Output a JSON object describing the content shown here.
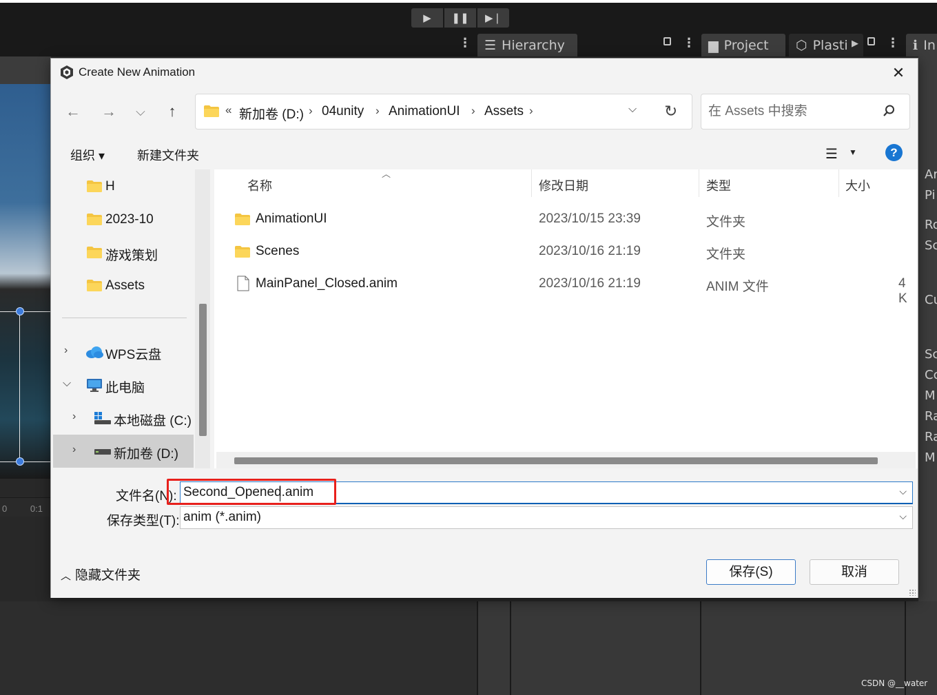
{
  "unity": {
    "tabs": {
      "hierarchy": "Hierarchy",
      "project": "Project",
      "plastic": "Plasti",
      "inspector": "In"
    },
    "right_strip_labels": [
      "Ar",
      "Pi",
      "Ro",
      "Sc",
      "Cu",
      "Sc",
      "Cc",
      "M",
      "Ra",
      "Ra",
      "M"
    ],
    "timeline_ticks": [
      "0",
      "0:1"
    ],
    "watermark": "CSDN @__water"
  },
  "dialog": {
    "title": "Create New Animation",
    "close_glyph": "✕",
    "nav": {
      "back_glyph": "←",
      "forward_glyph": "→",
      "recent_glyph": "⌵",
      "up_glyph": "↑",
      "breadcrumb_prefix": "«",
      "breadcrumbs": [
        "新加卷 (D:)",
        "04unity",
        "AnimationUI",
        "Assets"
      ],
      "search_placeholder": "在 Assets 中搜索"
    },
    "toolbar": {
      "organize": "组织 ▾",
      "new_folder": "新建文件夹",
      "help": "?"
    },
    "sidebar": {
      "quick_items": [
        "H",
        "2023-10",
        "游戏策划",
        "Assets"
      ],
      "wps": "WPS云盘",
      "this_pc": "此电脑",
      "drive_c": "本地磁盘 (C:)",
      "drive_d": "新加卷 (D:)"
    },
    "columns": {
      "name": "名称",
      "date": "修改日期",
      "type": "类型",
      "size": "大小"
    },
    "files": [
      {
        "name": "AnimationUI",
        "date": "2023/10/15 23:39",
        "type": "文件夹",
        "size": "",
        "kind": "folder"
      },
      {
        "name": "Scenes",
        "date": "2023/10/16 21:19",
        "type": "文件夹",
        "size": "",
        "kind": "folder"
      },
      {
        "name": "MainPanel_Closed.anim",
        "date": "2023/10/16 21:19",
        "type": "ANIM 文件",
        "size": "4 K",
        "kind": "file"
      }
    ],
    "form": {
      "filename_label": "文件名(N):",
      "filename_value": "Second_Opened.anim",
      "filetype_label": "保存类型(T):",
      "filetype_value": "anim (*.anim)"
    },
    "footer": {
      "hide_folders": "隐藏文件夹",
      "save": "保存(S)",
      "cancel": "取消"
    }
  },
  "colors": {
    "highlight": "#e8201c",
    "accent": "#1976d2",
    "unity_bg": "#282828",
    "folder": "#f4c542"
  }
}
